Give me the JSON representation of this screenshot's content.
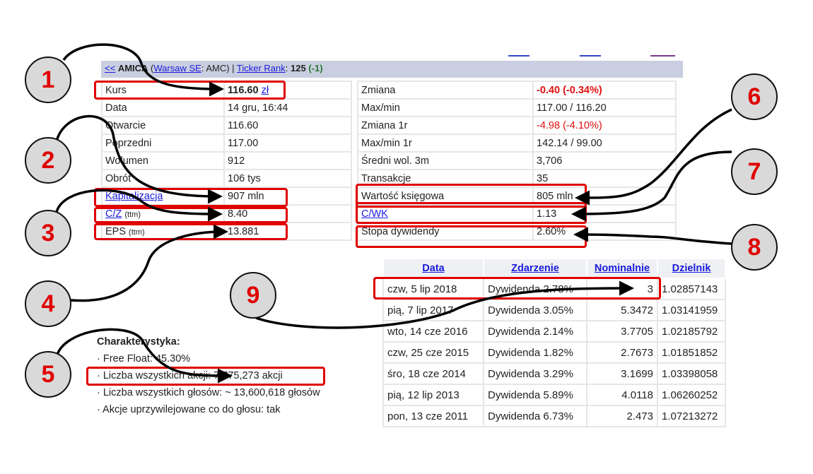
{
  "header": {
    "back": "<<",
    "name": "AMICA",
    "exchange": "Warsaw SE",
    "ticker": "AMC",
    "rank_label": "Ticker Rank",
    "rank": "125",
    "rank_change": "(-1)"
  },
  "left": [
    {
      "label": "Kurs",
      "value": "116.60",
      "unit": "zł"
    },
    {
      "label": "Data",
      "value": "14 gru, 16:44"
    },
    {
      "label": "Otwarcie",
      "value": "116.60"
    },
    {
      "label": "Poprzedni",
      "value": "117.00"
    },
    {
      "label": "Wolumen",
      "value": "912"
    },
    {
      "label": "Obrót",
      "value": "106 tys"
    },
    {
      "label": "Kapitalizacja",
      "value": "907 mln"
    },
    {
      "label": "C/Z",
      "sub": "(ttm)",
      "value": "8.40"
    },
    {
      "label": "EPS",
      "sub": "(ttm)",
      "value": "13.881"
    }
  ],
  "right": [
    {
      "label": "Zmiana",
      "value": "-0.40 (-0.34%)"
    },
    {
      "label": "Max/min",
      "value": "117.00 / 116.20"
    },
    {
      "label": "Zmiana 1r",
      "value": "-4.98 (-4.10%)"
    },
    {
      "label": "Max/min 1r",
      "value": "142.14 / 99.00"
    },
    {
      "label": "Średni wol. 3m",
      "value": "3,706"
    },
    {
      "label": "Transakcje",
      "value": "35"
    },
    {
      "label": "Wartość księgowa",
      "value": "805 mln"
    },
    {
      "label": "C/WK",
      "value": "1.13"
    },
    {
      "label": "Stopa dywidendy",
      "value": "2.60%"
    }
  ],
  "dividends": {
    "headers": [
      "Data",
      "Zdarzenie",
      "Nominalnie",
      "Dzielnik"
    ],
    "rows": [
      [
        "czw, 5 lip 2018",
        "Dywidenda 2.78%",
        "3",
        "1.02857143"
      ],
      [
        "pią, 7 lip 2017",
        "Dywidenda 3.05%",
        "5.3472",
        "1.03141959"
      ],
      [
        "wto, 14 cze 2016",
        "Dywidenda 2.14%",
        "3.7705",
        "1.02185792"
      ],
      [
        "czw, 25 cze 2015",
        "Dywidenda 1.82%",
        "2.7673",
        "1.01851852"
      ],
      [
        "śro, 18 cze 2014",
        "Dywidenda 3.29%",
        "3.1699",
        "1.03398058"
      ],
      [
        "pią, 12 lip 2013",
        "Dywidenda 5.89%",
        "4.0118",
        "1.06260252"
      ],
      [
        "pon, 13 cze 2011",
        "Dywidenda 6.73%",
        "2.473",
        "1.07213272"
      ]
    ]
  },
  "characteristics": {
    "title": "Charakterystyka:",
    "items": [
      "· Free Float: 45.30%",
      "· Liczba wszystkich akcji: 7,775,273 akcji",
      "· Liczba wszystkich głosów: ~ 13,600,618 głosów",
      "· Akcje uprzywilejowane co do głosu: tak"
    ]
  },
  "callouts": [
    "1",
    "2",
    "3",
    "4",
    "5",
    "6",
    "7",
    "8",
    "9"
  ],
  "colors": {
    "accent": "#e00000",
    "header_bg": "#c9cfe0",
    "link": "#1a1adb"
  }
}
